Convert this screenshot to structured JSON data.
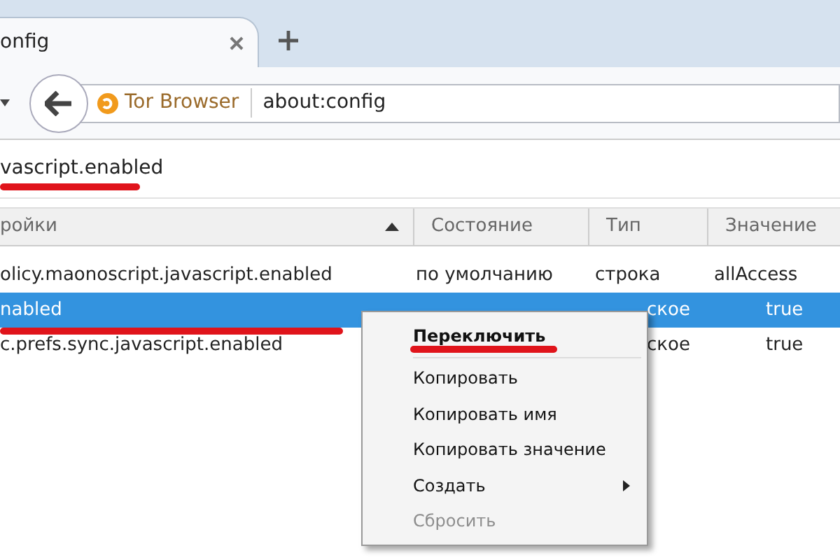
{
  "tabs": [
    {
      "title": "onfig",
      "selected": true
    }
  ],
  "toolbar": {
    "identity": "Tor Browser",
    "url": "about:config"
  },
  "search": {
    "value": "vascript.enabled",
    "underlined": true
  },
  "table": {
    "columns": [
      {
        "label": "ройки",
        "sorted": true
      },
      {
        "label": "Состояние"
      },
      {
        "label": "Тип"
      },
      {
        "label": "Значение"
      }
    ],
    "rows": [
      {
        "name": "olicy.maonoscript.javascript.enabled",
        "state": "по умолчанию",
        "type": "строка",
        "value": "allAccess",
        "selected": false
      },
      {
        "name": "nabled",
        "type": "ское",
        "value": "true",
        "selected": true,
        "underlined": true
      },
      {
        "name": "c.prefs.sync.javascript.enabled",
        "type": "ское",
        "value": "true",
        "selected": false
      }
    ]
  },
  "context_menu": {
    "items": [
      {
        "label": "Переключить",
        "default": true,
        "underlined": true,
        "disabled": false
      },
      {
        "label": "Копировать",
        "default": false,
        "disabled": false
      },
      {
        "label": "Копировать имя",
        "default": false,
        "disabled": false
      },
      {
        "label": "Копировать значение",
        "default": false,
        "disabled": false
      },
      {
        "label": "Создать",
        "default": false,
        "submenu": true,
        "disabled": false
      },
      {
        "label": "Сбросить",
        "default": false,
        "disabled": true
      }
    ]
  }
}
